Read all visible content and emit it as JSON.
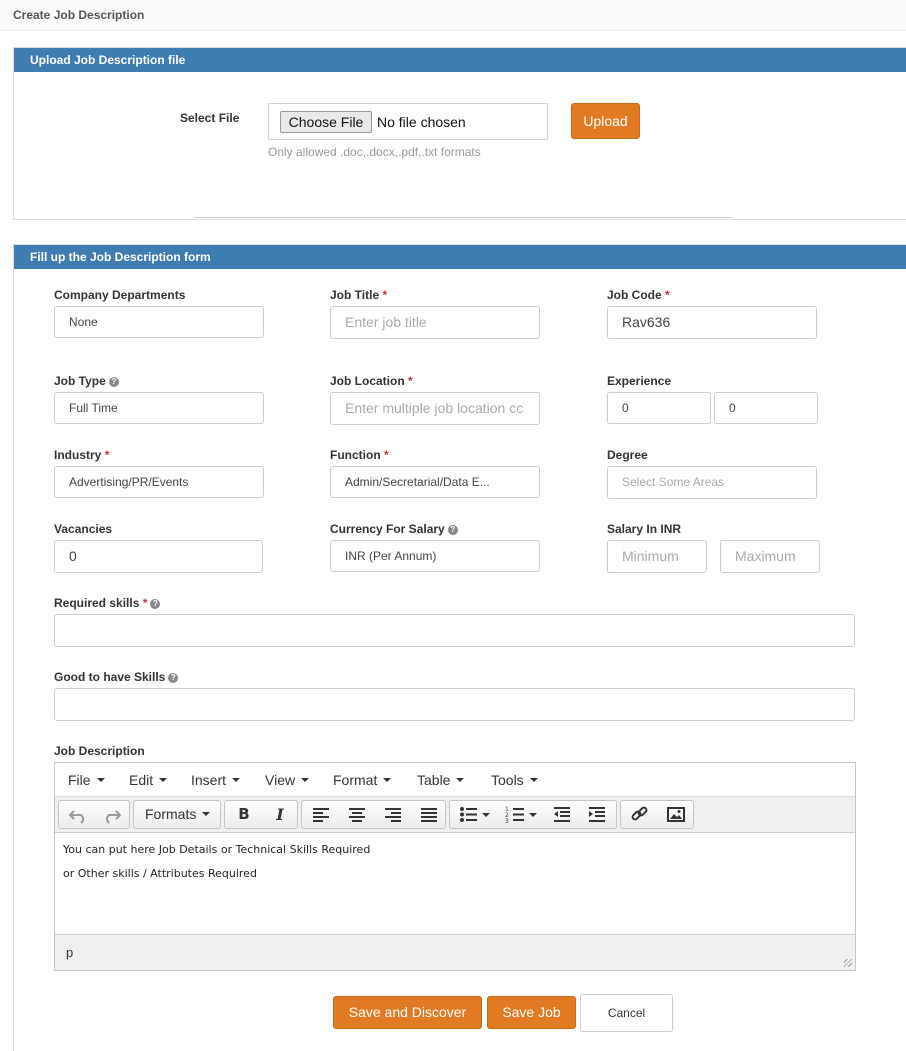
{
  "page": {
    "title": "Create Job Description"
  },
  "upload_panel": {
    "heading": "Upload Job Description file",
    "select_label": "Select File",
    "choose_button": "Choose File",
    "file_status": "No file chosen",
    "hint": "Only allowed .doc,.docx,.pdf,.txt formats",
    "upload_button": "Upload"
  },
  "form_panel": {
    "heading": "Fill up the Job Description form",
    "fields": {
      "company_departments": {
        "label": "Company Departments",
        "value": "None"
      },
      "job_title": {
        "label": "Job Title",
        "required": "*",
        "placeholder": "Enter job title"
      },
      "job_code": {
        "label": "Job Code",
        "required": "*",
        "value": "Rav636"
      },
      "job_type": {
        "label": "Job Type",
        "value": "Full Time"
      },
      "job_location": {
        "label": "Job Location",
        "required": "*",
        "placeholder": "Enter multiple job location cc"
      },
      "experience": {
        "label": "Experience",
        "min": "0",
        "max": "0"
      },
      "industry": {
        "label": "Industry",
        "required": "*",
        "value": "Advertising/PR/Events"
      },
      "function": {
        "label": "Function",
        "required": "*",
        "value": "Admin/Secretarial/Data E..."
      },
      "degree": {
        "label": "Degree",
        "placeholder": "Select Some Areas"
      },
      "vacancies": {
        "label": "Vacancies",
        "value": "0"
      },
      "currency": {
        "label": "Currency For Salary",
        "value": "INR (Per Annum)"
      },
      "salary": {
        "label": "Salary In INR",
        "min_placeholder": "Minimum",
        "max_placeholder": "Maximum"
      },
      "required_skills": {
        "label": "Required skills",
        "required": "*"
      },
      "good_skills": {
        "label": "Good to have Skills"
      },
      "job_description": {
        "label": "Job Description"
      }
    },
    "help_glyph": "?"
  },
  "editor": {
    "menus": [
      "File",
      "Edit",
      "Insert",
      "View",
      "Format",
      "Table",
      "Tools"
    ],
    "formats_label": "Formats",
    "content_lines": [
      "You can put here Job Details or Technical Skills Required",
      "or Other skills / Attributes Required"
    ],
    "status_path": "p"
  },
  "actions": {
    "save_discover": "Save and Discover",
    "save_job": "Save Job",
    "cancel": "Cancel"
  },
  "colors": {
    "panel_header": "#3e7cb1",
    "accent_orange": "#e07b24",
    "required_star": "#c9302c"
  },
  "icons": [
    "undo-icon",
    "redo-icon",
    "bold-icon",
    "italic-icon",
    "align-left-icon",
    "align-center-icon",
    "align-right-icon",
    "align-justify-icon",
    "bullet-list-icon",
    "numbered-list-icon",
    "outdent-icon",
    "indent-icon",
    "link-icon",
    "image-icon",
    "help-icon",
    "resize-handle-icon"
  ]
}
